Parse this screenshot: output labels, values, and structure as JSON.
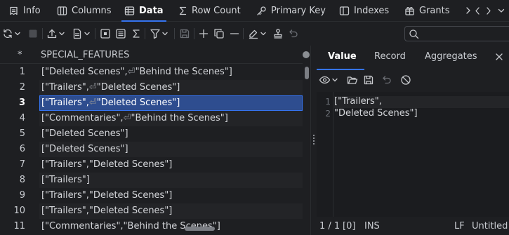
{
  "tabs": [
    {
      "label": "Info",
      "icon": "info-icon"
    },
    {
      "label": "Columns",
      "icon": "columns-icon"
    },
    {
      "label": "Data",
      "icon": "table-icon"
    },
    {
      "label": "Row Count",
      "icon": "sigma-icon"
    },
    {
      "label": "Primary Key",
      "icon": "key-icon"
    },
    {
      "label": "Indexes",
      "icon": "indexes-icon"
    },
    {
      "label": "Grants",
      "icon": "grants-icon"
    }
  ],
  "active_tab": "Data",
  "grid": {
    "header_marker": "*",
    "column": "SPECIAL_FEATURES",
    "rows": [
      {
        "num": "1",
        "parts": [
          "[\"Deleted Scenes\",",
          "\"Behind the Scenes\"]"
        ]
      },
      {
        "num": "2",
        "parts": [
          "[\"Trailers\",",
          "\"Deleted Scenes\"]"
        ]
      },
      {
        "num": "3",
        "parts": [
          "[\"Trailers\",",
          "\"Deleted Scenes\"]"
        ]
      },
      {
        "num": "4",
        "parts": [
          "[\"Commentaries\",",
          "\"Behind the Scenes\"]"
        ]
      },
      {
        "num": "5",
        "parts": [
          "[\"Deleted Scenes\"]"
        ]
      },
      {
        "num": "6",
        "parts": [
          "[\"Deleted Scenes\"]"
        ]
      },
      {
        "num": "7",
        "parts": [
          "[\"Trailers\",\"Deleted Scenes\"]"
        ]
      },
      {
        "num": "8",
        "parts": [
          "[\"Trailers\"]"
        ]
      },
      {
        "num": "9",
        "parts": [
          "[\"Trailers\",\"Deleted Scenes\"]"
        ]
      },
      {
        "num": "10",
        "parts": [
          "[\"Trailers\",\"Deleted Scenes\"]"
        ]
      },
      {
        "num": "11",
        "parts": [
          "[\"Commentaries\",\"Behind the Scenes\"]"
        ]
      }
    ],
    "selected_row": "3",
    "newline_glyph": "⏎"
  },
  "value_panel": {
    "tabs": [
      "Value",
      "Record",
      "Aggregates"
    ],
    "active_tab": "Value",
    "lines": [
      {
        "num": "1",
        "text": "[\"Trailers\","
      },
      {
        "num": "2",
        "text": "\"Deleted Scenes\"]"
      }
    ],
    "status": {
      "position": "1 / 1",
      "index": "[0]",
      "mode": "INS",
      "line_ending": "LF",
      "file": "Untitled"
    }
  },
  "colors": {
    "accent": "#3574f0",
    "selection": "#2e4d8f",
    "background": "#1e1f22"
  }
}
